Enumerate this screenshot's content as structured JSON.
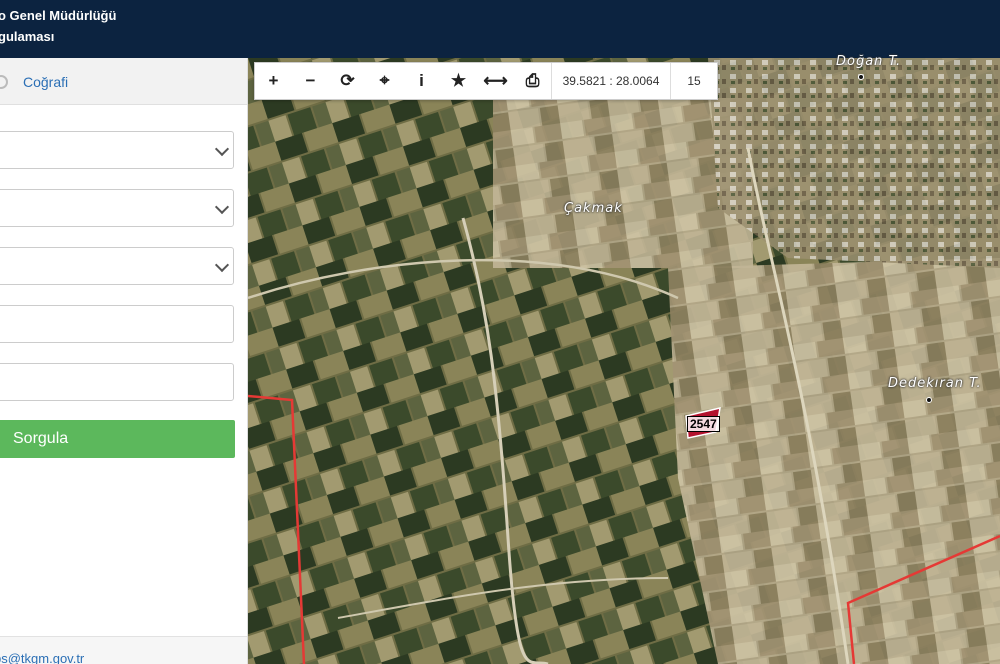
{
  "header": {
    "title_line1": "o Genel Müdürlüğü",
    "title_line2": "gulaması"
  },
  "sidebar": {
    "tab_label": "Coğrafi",
    "query_button": "Sorgula",
    "footer_email": "bs@tkgm.gov.tr"
  },
  "map": {
    "coordinates": "39.5821 : 28.0064",
    "zoom": "15",
    "places": [
      "Doğan T.",
      "Çakmak",
      "Dedekıran T."
    ],
    "parcel_number": "2547",
    "colors": {
      "boundary": "#e53935",
      "parcel": "#b3122e",
      "header": "#0c2340",
      "button": "#5cb85c"
    }
  },
  "toolbar": {
    "icons": [
      "zoom-in-icon",
      "zoom-out-icon",
      "refresh-icon",
      "locate-icon",
      "info-icon",
      "favorite-icon",
      "measure-icon",
      "print-icon"
    ],
    "zoom_in": "+",
    "zoom_out": "−",
    "refresh": "⟳",
    "locate": "⌖",
    "info": "i",
    "favorite": "★",
    "measure": "⟷",
    "print": "⎙"
  }
}
